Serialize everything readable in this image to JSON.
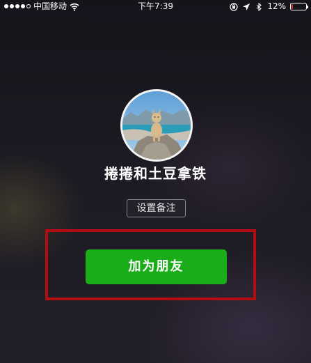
{
  "status_bar": {
    "carrier": "中国移动",
    "time": "下午7:39",
    "battery_percent_text": "12%",
    "battery_level": 0.12,
    "battery_color": "#e53935",
    "icons": [
      "signal-dots",
      "wifi-icon",
      "rotation-lock-icon",
      "location-arrow-icon",
      "bluetooth-icon",
      "battery-icon"
    ]
  },
  "profile": {
    "avatar_icon": "cat-on-rock-photo",
    "nickname": "捲捲和土豆拿铁"
  },
  "actions": {
    "remark_label": "设置备注",
    "add_friend_label": "加为朋友",
    "add_friend_color": "#1aad19"
  },
  "annotation": {
    "highlight_color": "#b10d12"
  }
}
